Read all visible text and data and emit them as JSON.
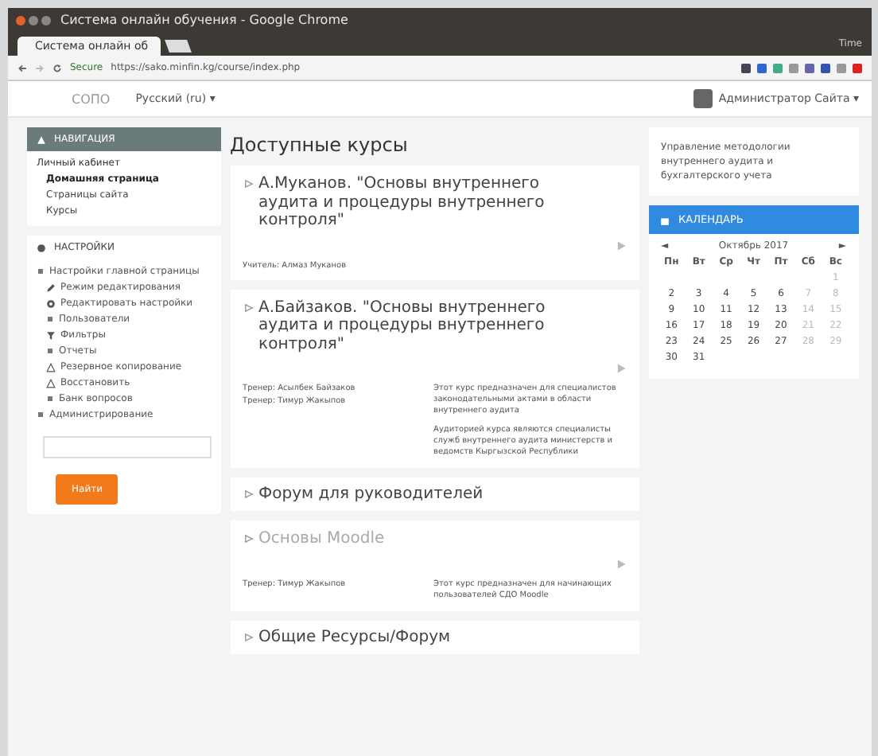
{
  "browser": {
    "title": "Система онлайн обучения - Google Chrome",
    "tab": "Система онлайн об",
    "user": "Time",
    "secure": "Secure",
    "url": "https://sako.minfin.kg/course/index.php"
  },
  "header": {
    "site": "СОПО",
    "language": "Русский (ru) ▾",
    "user": "Администратор Сайта ▾"
  },
  "navigation": {
    "title": "НАВИГАЦИЯ",
    "root": "Личный кабинет",
    "items": [
      {
        "label": "Домашняя страница",
        "selected": true
      },
      {
        "label": "Страницы сайта",
        "selected": false
      },
      {
        "label": "Курсы",
        "selected": false
      }
    ]
  },
  "settings": {
    "title": "НАСТРОЙКИ",
    "items": [
      {
        "label": "Настройки главной страницы",
        "kind": "folder",
        "children": [
          {
            "label": "Режим редактирования",
            "kind": "pencil"
          },
          {
            "label": "Редактировать настройки",
            "kind": "gear"
          },
          {
            "label": "Пользователи",
            "kind": "folder"
          },
          {
            "label": "Фильтры",
            "kind": "filter"
          },
          {
            "label": "Отчеты",
            "kind": "folder"
          },
          {
            "label": "Резервное копирование",
            "kind": "upload"
          },
          {
            "label": "Восстановить",
            "kind": "upload"
          },
          {
            "label": "Банк вопросов",
            "kind": "folder"
          }
        ]
      },
      {
        "label": "Администрирование",
        "kind": "folder"
      }
    ],
    "search_button": "Найти"
  },
  "main": {
    "title": "Доступные курсы",
    "items": [
      {
        "kind": "course",
        "title": "А.Муканов. \"Основы внутреннего аудита и процедуры внутреннего контроля\"",
        "dimmed": false,
        "teachers": [
          "Учитель: Алмаз Муканов"
        ]
      },
      {
        "kind": "course",
        "title": "А.Байзаков. \"Основы внутреннего аудита и процедуры внутреннего контроля\"",
        "dimmed": false,
        "teachers": [
          "Тренер: Асылбек Байзаков",
          "Тренер: Тимур Жакыпов"
        ],
        "summary": [
          "Этот курс предназначен для специалистов законодательными актами в области внутреннего аудита",
          "Аудиторией курса являются специалисты служб внутреннего аудита министерств и ведомств Кыргызской Республики"
        ]
      },
      {
        "kind": "category",
        "title": "Форум для руководителей"
      },
      {
        "kind": "course",
        "title": "Основы Moodle",
        "dimmed": true,
        "teachers": [
          "Тренер: Тимур Жакыпов"
        ],
        "summary": [
          "Этот курс предназначен для начинающих пользователей СДО Moodle"
        ]
      },
      {
        "kind": "category",
        "title": "Общие Ресурсы/Форум"
      }
    ]
  },
  "org_block": {
    "text": "Управление методологии внутреннего аудита и бухгалтерского учета"
  },
  "calendar": {
    "title": "КАЛЕНДАРЬ",
    "prev": "◄",
    "month": "Октябрь 2017",
    "next": "►",
    "weekdays": [
      {
        "label": "Пн",
        "weekend": false
      },
      {
        "label": "Вт",
        "weekend": false
      },
      {
        "label": "Ср",
        "weekend": false
      },
      {
        "label": "Чт",
        "weekend": false
      },
      {
        "label": "Пт",
        "weekend": false
      },
      {
        "label": "Сб",
        "weekend": false
      },
      {
        "label": "Вс",
        "weekend": false
      }
    ],
    "days": [
      {
        "day": "1",
        "weekend": true
      },
      {
        "day": "2",
        "weekend": false
      },
      {
        "day": "3",
        "weekend": false
      },
      {
        "day": "4",
        "weekend": false
      },
      {
        "day": "5",
        "weekend": false
      },
      {
        "day": "6",
        "weekend": false
      },
      {
        "day": "7",
        "weekend": true
      },
      {
        "day": "8",
        "weekend": true
      },
      {
        "day": "9",
        "weekend": false
      },
      {
        "day": "10",
        "weekend": false
      },
      {
        "day": "11",
        "weekend": false
      },
      {
        "day": "12",
        "weekend": false
      },
      {
        "day": "13",
        "weekend": false
      },
      {
        "day": "14",
        "weekend": true
      },
      {
        "day": "15",
        "weekend": true
      },
      {
        "day": "16",
        "weekend": false
      },
      {
        "day": "17",
        "weekend": false
      },
      {
        "day": "18",
        "weekend": false
      },
      {
        "day": "19",
        "weekend": false
      },
      {
        "day": "20",
        "weekend": false
      },
      {
        "day": "21",
        "weekend": true
      },
      {
        "day": "22",
        "weekend": true
      },
      {
        "day": "23",
        "weekend": false
      },
      {
        "day": "24",
        "weekend": false
      },
      {
        "day": "25",
        "weekend": false
      },
      {
        "day": "26",
        "weekend": false
      },
      {
        "day": "27",
        "weekend": false
      },
      {
        "day": "28",
        "weekend": true
      },
      {
        "day": "29",
        "weekend": true
      },
      {
        "day": "30",
        "weekend": false
      },
      {
        "day": "31",
        "weekend": false
      }
    ]
  }
}
